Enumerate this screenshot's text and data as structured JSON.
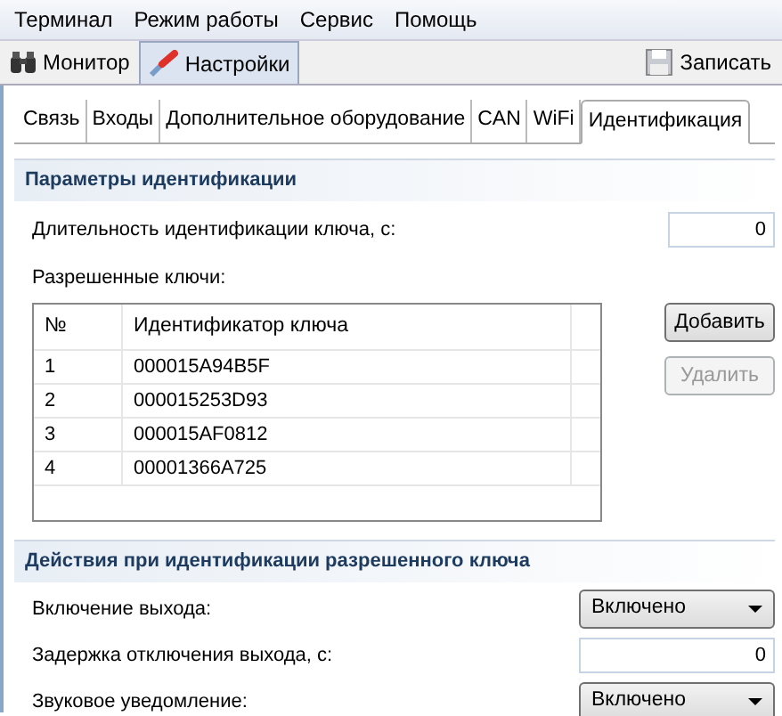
{
  "menu": [
    "Терминал",
    "Режим работы",
    "Сервис",
    "Помощь"
  ],
  "main_tabs": [
    {
      "label": "Монитор",
      "selected": false
    },
    {
      "label": "Настройки",
      "selected": true
    }
  ],
  "save_button": "Записать",
  "sub_tabs": [
    {
      "label": "Связь",
      "selected": false
    },
    {
      "label": "Входы",
      "selected": false
    },
    {
      "label": "Дополнительное оборудование",
      "selected": false
    },
    {
      "label": "CAN",
      "selected": false
    },
    {
      "label": "WiFi",
      "selected": false
    },
    {
      "label": "Идентификация",
      "selected": true
    }
  ],
  "identification": {
    "title": "Параметры идентификации",
    "duration_label": "Длительность идентификации ключа, с:",
    "duration_value": "0",
    "keys_label": "Разрешенные ключи:",
    "columns": [
      "№",
      "Идентификатор ключа"
    ],
    "rows": [
      [
        "1",
        "000015A94B5F"
      ],
      [
        "2",
        "000015253D93"
      ],
      [
        "3",
        "000015AF0812"
      ],
      [
        "4",
        "00001366A725"
      ]
    ],
    "buttons": [
      {
        "label": "Добавить",
        "disabled": false
      },
      {
        "label": "Удалить",
        "disabled": true
      }
    ]
  },
  "actions": {
    "title": "Действия при идентификации разрешенного ключа",
    "rows": [
      {
        "kind": "select",
        "label": "Включение выхода:",
        "value": "Включено"
      },
      {
        "kind": "input",
        "label": "Задержка отключения выхода, с:",
        "value": "0"
      },
      {
        "kind": "select",
        "label": "Звуковое уведомление:",
        "value": "Включено"
      }
    ]
  }
}
